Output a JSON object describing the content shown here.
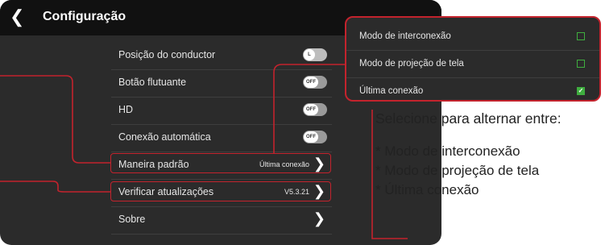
{
  "header": {
    "back_icon": "chevron-left-icon",
    "title": "Configuração"
  },
  "settings": {
    "driver_position": {
      "label": "Posição do conductor",
      "toggle_text": "L"
    },
    "floating_button": {
      "label": "Botão flutuante",
      "toggle_text": "OFF"
    },
    "hd": {
      "label": "HD",
      "toggle_text": "OFF"
    },
    "auto_connect": {
      "label": "Conexão automática",
      "toggle_text": "OFF"
    },
    "default_mode": {
      "label": "Maneira padrão",
      "value": "Última conexão"
    },
    "check_updates": {
      "label": "Verificar atualizações",
      "value": "V5.3.21"
    },
    "about": {
      "label": "Sobre"
    }
  },
  "popup": {
    "options": [
      {
        "label": "Modo de interconexão",
        "checked": false
      },
      {
        "label": "Modo de projeção de tela",
        "checked": false
      },
      {
        "label": "Última conexão",
        "checked": true
      }
    ]
  },
  "callout": {
    "heading": "Selecione para alternar entre:",
    "items": [
      "* Modo de interconexão",
      "* Modo de projeção de tela",
      "* Última conexão"
    ]
  },
  "colors": {
    "accent_red": "#c3232d",
    "check_green": "#3fae3f",
    "panel": "#2b2b2b",
    "titlebar": "#111111"
  }
}
